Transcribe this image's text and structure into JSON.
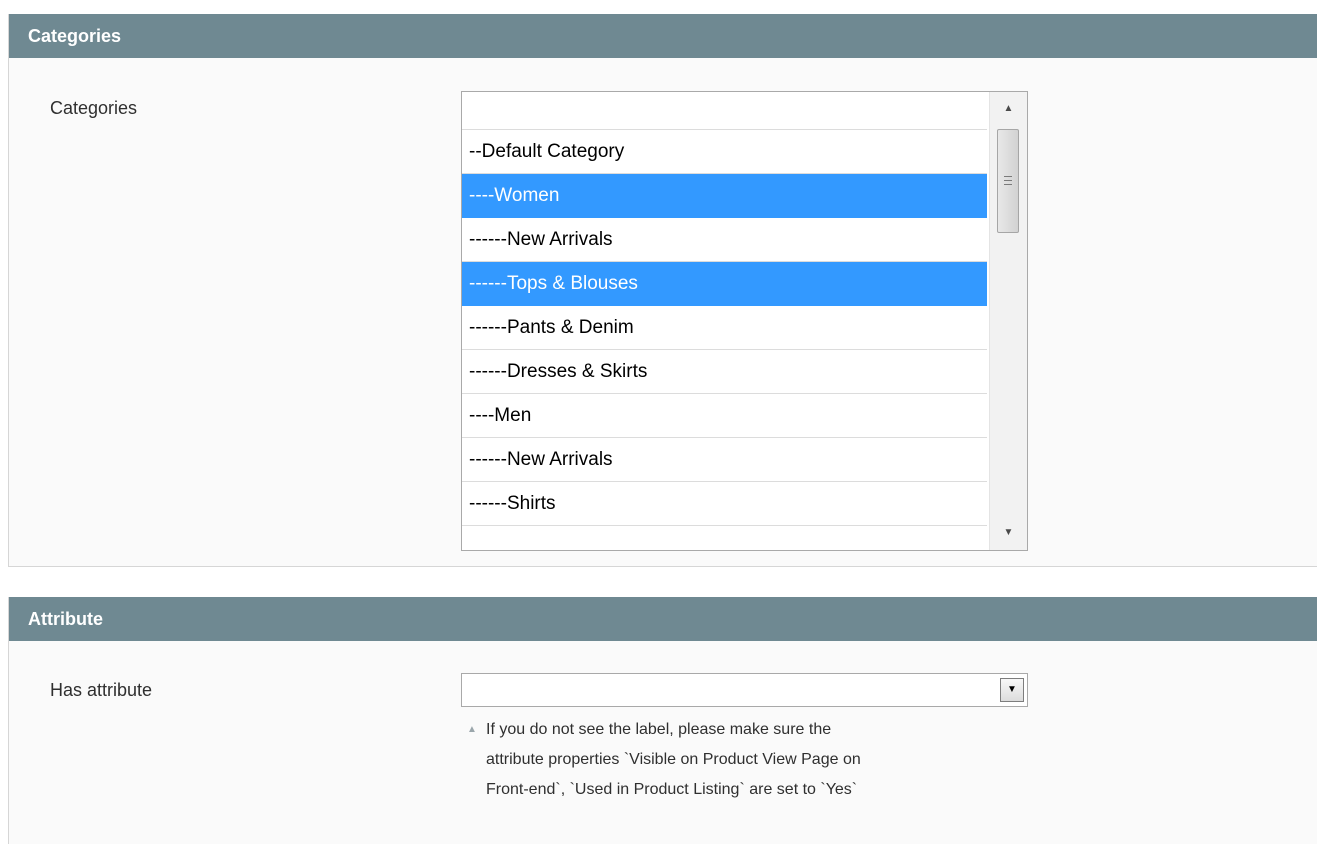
{
  "categories_section": {
    "header": "Categories",
    "field_label": "Categories",
    "options": [
      {
        "label": "",
        "selected": false
      },
      {
        "label": "--Default Category",
        "selected": false
      },
      {
        "label": "----Women",
        "selected": true
      },
      {
        "label": "------New Arrivals",
        "selected": false
      },
      {
        "label": "------Tops & Blouses",
        "selected": true
      },
      {
        "label": "------Pants & Denim",
        "selected": false
      },
      {
        "label": "------Dresses & Skirts",
        "selected": false
      },
      {
        "label": "----Men",
        "selected": false
      },
      {
        "label": "------New Arrivals",
        "selected": false
      },
      {
        "label": "------Shirts",
        "selected": false
      }
    ]
  },
  "attribute_section": {
    "header": "Attribute",
    "field_label": "Has attribute",
    "select_value": "",
    "note_lines": [
      "If you do not see the label, please make sure the",
      "attribute properties `Visible on Product View Page on",
      "Front-end`, `Used in Product Listing` are set to `Yes`"
    ]
  },
  "icons": {
    "scroll_up": "▲",
    "scroll_down": "▼",
    "dropdown": "▼",
    "note": "▲"
  },
  "colors": {
    "header_bg": "#6f8992",
    "selected_bg": "#3399ff"
  }
}
